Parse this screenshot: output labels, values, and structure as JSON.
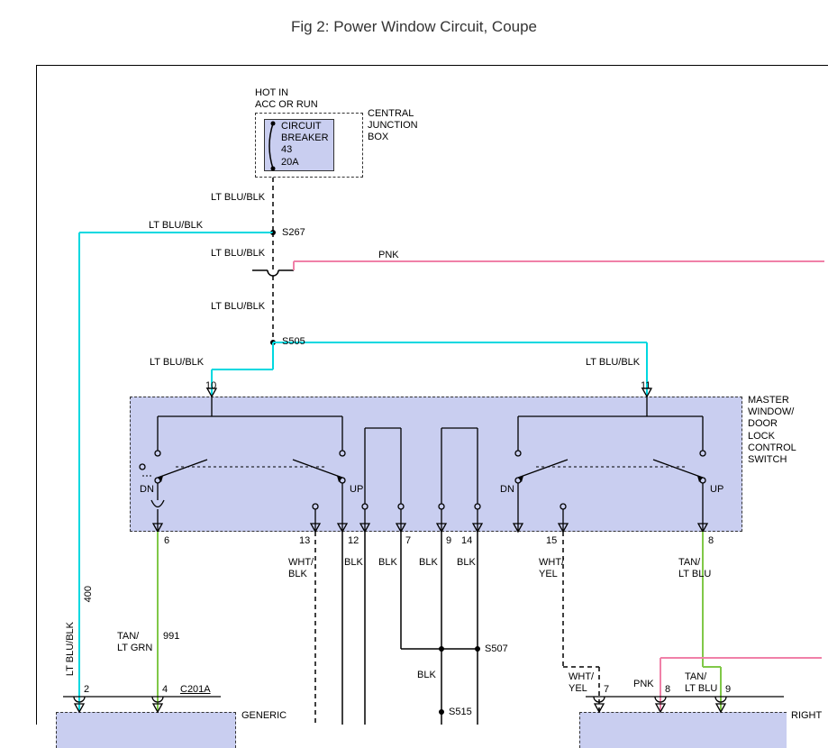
{
  "title": "Fig 2: Power Window Circuit, Coupe",
  "labels": {
    "hot_in": "HOT IN\nACC OR RUN",
    "circuit_breaker": "CIRCUIT\nBREAKER\n43\n20A",
    "central_junction": "CENTRAL\nJUNCTION\nBOX",
    "ltblu_blk_v1": "LT BLU/BLK",
    "ltblu_blk_top": "LT BLU/BLK",
    "ltblu_blk_1": "LT BLU/BLK",
    "ltblu_blk_2": "LT BLU/BLK",
    "ltblu_blk_3": "LT BLU/BLK",
    "ltblu_blk_4": "LT BLU/BLK",
    "ltblu_blk_5": "LT BLU/BLK",
    "pnk_1": "PNK",
    "s267": "S267",
    "s505": "S505",
    "s507": "S507",
    "s515": "S515",
    "master_switch": "MASTER\nWINDOW/\nDOOR\nLOCK\nCONTROL\nSWITCH",
    "pin10": "10",
    "pin11": "11",
    "pin6": "6",
    "pin13": "13",
    "pin12": "12",
    "pin7": "7",
    "pin9": "9",
    "pin14": "14",
    "pin15": "15",
    "pin8": "8",
    "dn1": "DN",
    "up1": "UP",
    "dn2": "DN",
    "up2": "UP",
    "wht_blk": "WHT/\nBLK",
    "blk1": "BLK",
    "blk2": "BLK",
    "blk3": "BLK",
    "blk4": "BLK",
    "blk5": "BLK",
    "wht_yel1": "WHT/\nYEL",
    "wht_yel2": "WHT/\nYEL",
    "tan_ltblu1": "TAN/\nLT BLU",
    "tan_ltblu2": "TAN/\nLT BLU",
    "pnk2": "PNK",
    "tan_ltgrn": "TAN/\nLT GRN",
    "400": "400",
    "991": "991",
    "c201a": "C201A",
    "pin2b": "2",
    "pin4b": "4",
    "pin7b": "7",
    "pin8b": "8",
    "pin9b": "9",
    "generic": "GENERIC",
    "right": "RIGHT"
  },
  "colors": {
    "cyan": "#00D8E0",
    "pink": "#F080A8",
    "green": "#80C848",
    "black": "#000000"
  }
}
